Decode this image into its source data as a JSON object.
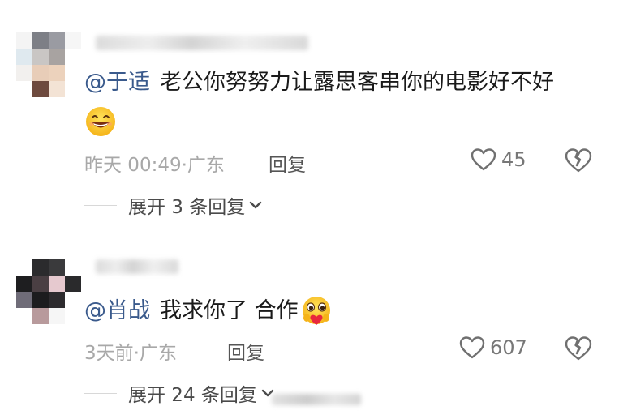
{
  "comments": [
    {
      "mention": "@于适",
      "text": "老公你努努力让露思客串你的电影好不好",
      "emoji": "grinning-smile-emoji",
      "time": "昨天 00:49",
      "separator": "·",
      "location": "广东",
      "reply_label": "回复",
      "likes": "45",
      "expand_label": "展开 3 条回复"
    },
    {
      "mention": "@肖战",
      "text": "我求你了 合作",
      "emoji": "hugging-heart-emoji",
      "time": "3天前",
      "separator": "·",
      "location": "广东",
      "reply_label": "回复",
      "likes": "607",
      "expand_label": "展开 24 条回复"
    }
  ],
  "icons": {
    "like": "heart-outline-icon",
    "dislike": "broken-heart-icon",
    "expand": "chevron-down-icon"
  },
  "colors": {
    "mention": "#3a5a8c",
    "text": "#1a1a1a",
    "meta": "#a8a8a8",
    "action": "#555555"
  }
}
